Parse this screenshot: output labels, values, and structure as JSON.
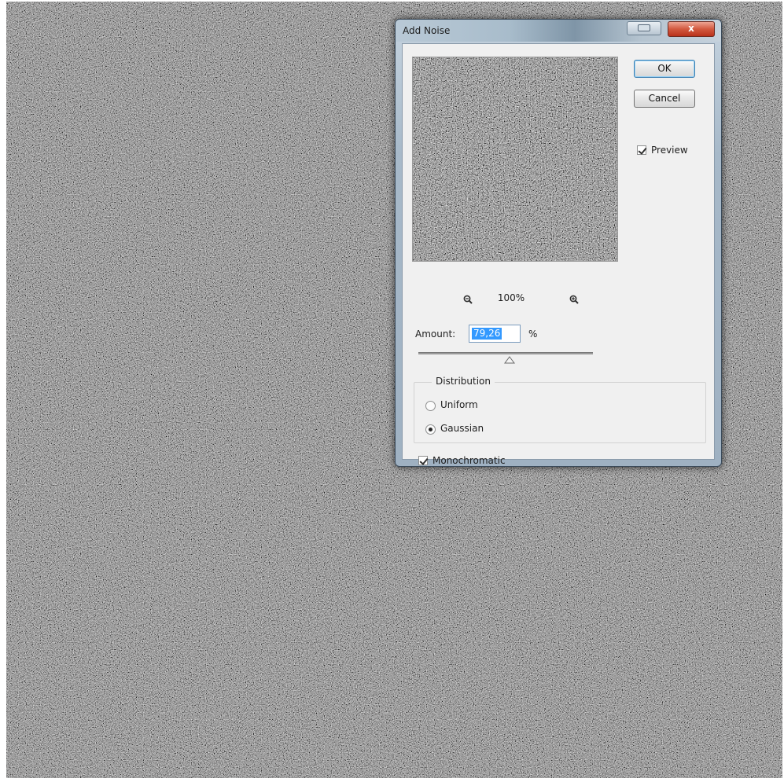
{
  "dialog": {
    "title": "Add Noise",
    "close_label": "x",
    "ok_label": "OK",
    "cancel_label": "Cancel",
    "preview_label": "Preview",
    "preview_checked": true,
    "zoom_level": "100%",
    "amount_label": "Amount:",
    "amount_value": "79,26",
    "amount_unit": "%",
    "distribution": {
      "legend": "Distribution",
      "options": [
        {
          "label": "Uniform",
          "selected": false
        },
        {
          "label": "Gaussian",
          "selected": true
        }
      ]
    },
    "monochromatic_label": "Monochromatic",
    "monochromatic_checked": true,
    "icons": [
      "help-icon",
      "close-icon",
      "zoom-out-icon",
      "zoom-in-icon",
      "slider-thumb-icon",
      "checkbox-check-icon"
    ]
  }
}
